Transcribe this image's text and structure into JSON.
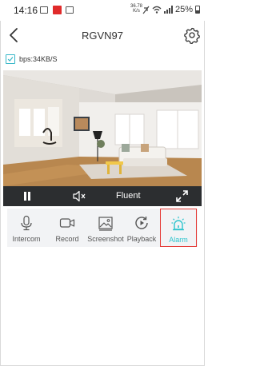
{
  "status_bar": {
    "time": "14:16",
    "net_speed_value": "36.78",
    "net_speed_unit": "K/s",
    "battery": "25%"
  },
  "header": {
    "title": "RGVN97"
  },
  "stream": {
    "bps_label": "bps:34KB/S"
  },
  "player_controls": {
    "quality_label": "Fluent"
  },
  "toolbar": {
    "items": [
      {
        "label": "Intercom",
        "icon": "microphone-icon"
      },
      {
        "label": "Record",
        "icon": "video-camera-icon"
      },
      {
        "label": "Screenshot",
        "icon": "image-icon"
      },
      {
        "label": "Playback",
        "icon": "playback-icon"
      },
      {
        "label": "Alarm",
        "icon": "alarm-siren-icon",
        "active": true
      }
    ]
  },
  "colors": {
    "accent": "#2ec4cd",
    "highlight_border": "#e53935",
    "control_bar": "#2c2e30",
    "toolbar_bg": "#f2f3f5"
  }
}
